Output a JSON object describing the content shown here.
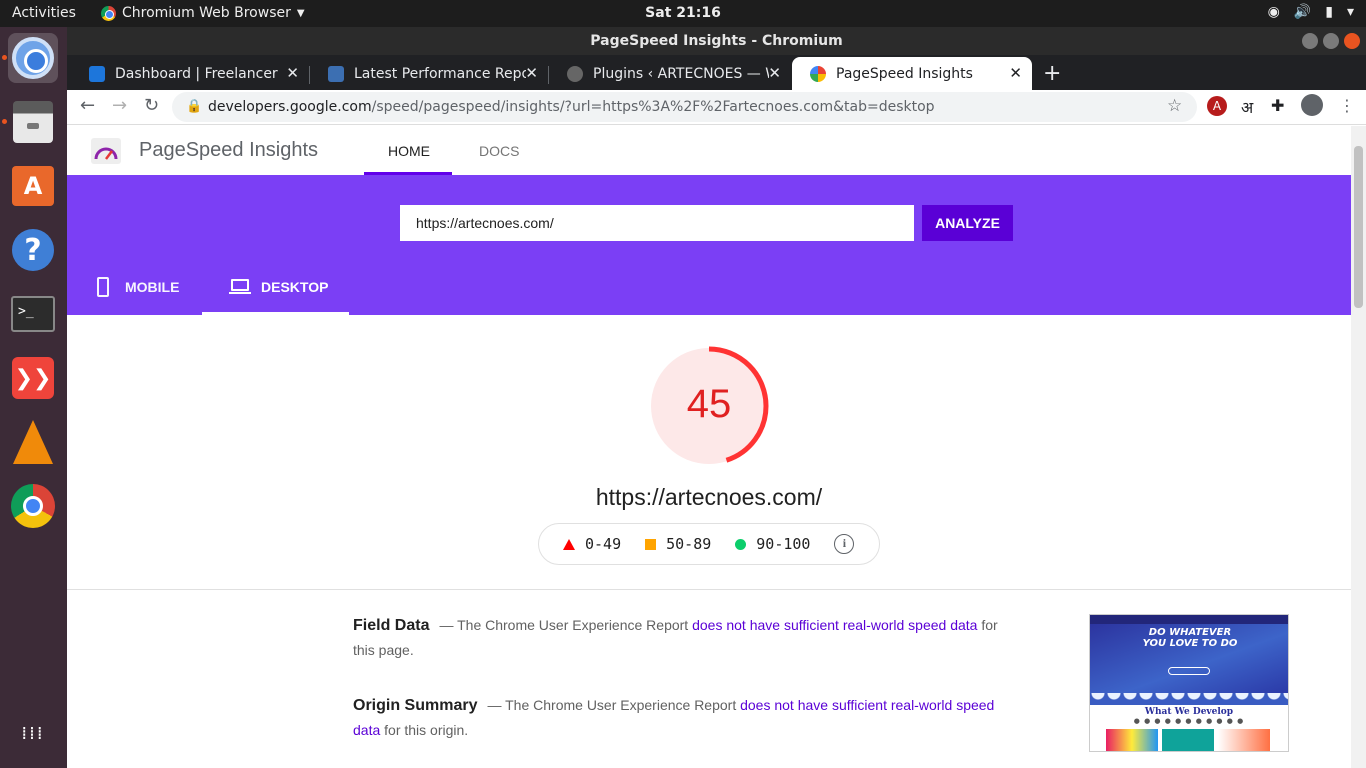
{
  "topbar": {
    "activities": "Activities",
    "app_name": "Chromium Web Browser",
    "clock": "Sat 21:16"
  },
  "window": {
    "title": "PageSpeed Insights - Chromium"
  },
  "tabs": [
    {
      "title": "Dashboard | Freelancer",
      "favicon_color": "#1d76db"
    },
    {
      "title": "Latest Performance Repo",
      "favicon_color": "#3c6fb2"
    },
    {
      "title": "Plugins ‹ ARTECNOES — W",
      "favicon_color": "#666666"
    },
    {
      "title": "PageSpeed Insights",
      "favicon_color": "#4285f4"
    }
  ],
  "omnibox": {
    "host": "developers.google.com",
    "path": "/speed/pagespeed/insights/?url=https%3A%2F%2Fartecnoes.com&tab=desktop"
  },
  "psi": {
    "title": "PageSpeed Insights",
    "nav_home": "HOME",
    "nav_docs": "DOCS",
    "url_value": "https://artecnoes.com/",
    "analyze": "ANALYZE",
    "tab_mobile": "MOBILE",
    "tab_desktop": "DESKTOP",
    "score": "45",
    "score_fraction": 0.45,
    "score_color": "#ff3333",
    "tested_url": "https://artecnoes.com/",
    "legend": {
      "fail": "0-49",
      "average": "50-89",
      "pass": "90-100"
    },
    "field_data": {
      "heading": "Field Data",
      "pre": "— The Chrome User Experience Report ",
      "link": "does not have sufficient real-world speed data",
      "post": " for this page."
    },
    "origin_summary": {
      "heading": "Origin Summary",
      "pre": "— The Chrome User Experience Report ",
      "link": "does not have sufficient real-world speed data",
      "post": " for this origin."
    },
    "thumbnail": {
      "headline_1": "DO WHATEVER",
      "headline_2": "YOU LOVE TO DO",
      "subheading": "What We Develop"
    }
  },
  "colors": {
    "accent": "#6200ea",
    "hero": "#7b3ff5",
    "fail": "#ff0000",
    "average": "#ffa400",
    "pass": "#0cce6b"
  }
}
